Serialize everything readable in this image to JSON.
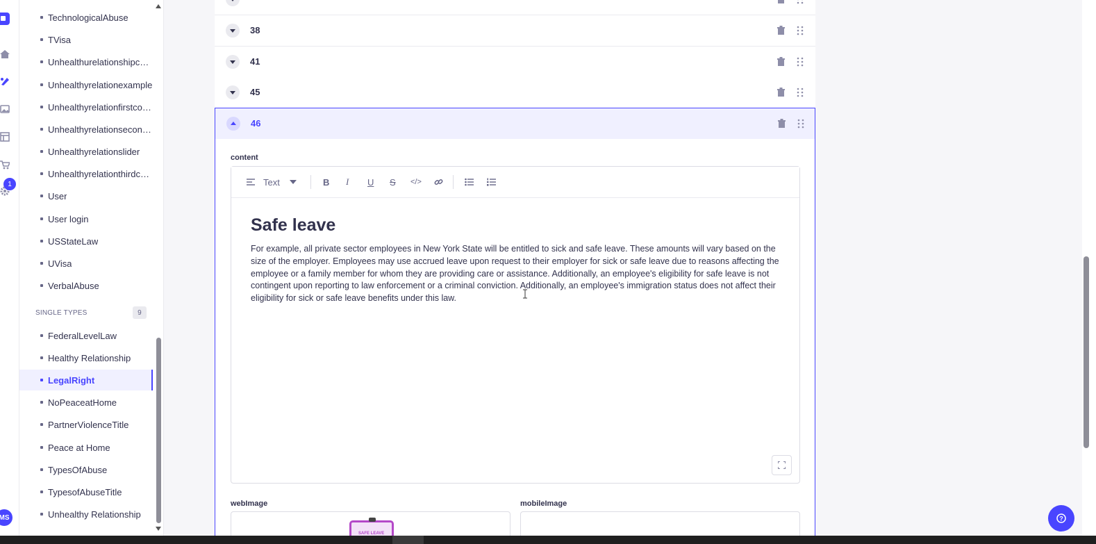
{
  "rail": {
    "badge": "1",
    "avatar": "MS",
    "icons": [
      "logo-icon",
      "home-icon",
      "content-builder-icon",
      "media-library-icon",
      "layout-icon",
      "marketplace-icon",
      "settings-icon"
    ]
  },
  "sidebar": {
    "collection_items": [
      "TechnologicalAbuse",
      "TVisa",
      "Unhealthurelationshipcon...",
      "Unhealthyrelationexample",
      "Unhealthyrelationfirstcon...",
      "Unhealthyrelationsecond...",
      "Unhealthyrelationslider",
      "Unhealthyrelationthirdco...",
      "User",
      "User login",
      "USStateLaw",
      "UVisa",
      "VerbalAbuse"
    ],
    "single_types_label": "SINGLE TYPES",
    "single_types_count": "9",
    "single_items": [
      "FederalLevelLaw",
      "Healthy Relationship",
      "LegalRight",
      "NoPeaceatHome",
      "PartnerViolenceTitle",
      "Peace at Home",
      "TypesOfAbuse",
      "TypesofAbuseTitle",
      "Unhealthy Relationship"
    ],
    "active_item": "LegalRight"
  },
  "components": {
    "rows": [
      "38",
      "41",
      "45"
    ],
    "open_row": "46"
  },
  "editor": {
    "field_label": "content",
    "block_type": "Text",
    "heading": "Safe leave",
    "body": "For example, all private sector employees in New York State will be entitled to sick and safe leave. These amounts will vary based on the size of the employer. Employees may use accrued leave upon request to their employer for sick or safe leave due to reasons affecting the employee or a family member for whom they are providing care or assistance. Additionally, an employee's eligibility for safe leave is not contingent upon reporting to law enforcement or a criminal conviction. Additionally, an employee's immigration status does not affect their eligibility for sick or safe leave benefits under this law.",
    "image_text": "SAFE LEAVE"
  },
  "media": {
    "web_label": "webImage",
    "mobile_label": "mobileImage"
  },
  "colors": {
    "accent": "#4945ff",
    "accent_light": "#f0f0ff",
    "text": "#32324d",
    "muted": "#666687"
  }
}
